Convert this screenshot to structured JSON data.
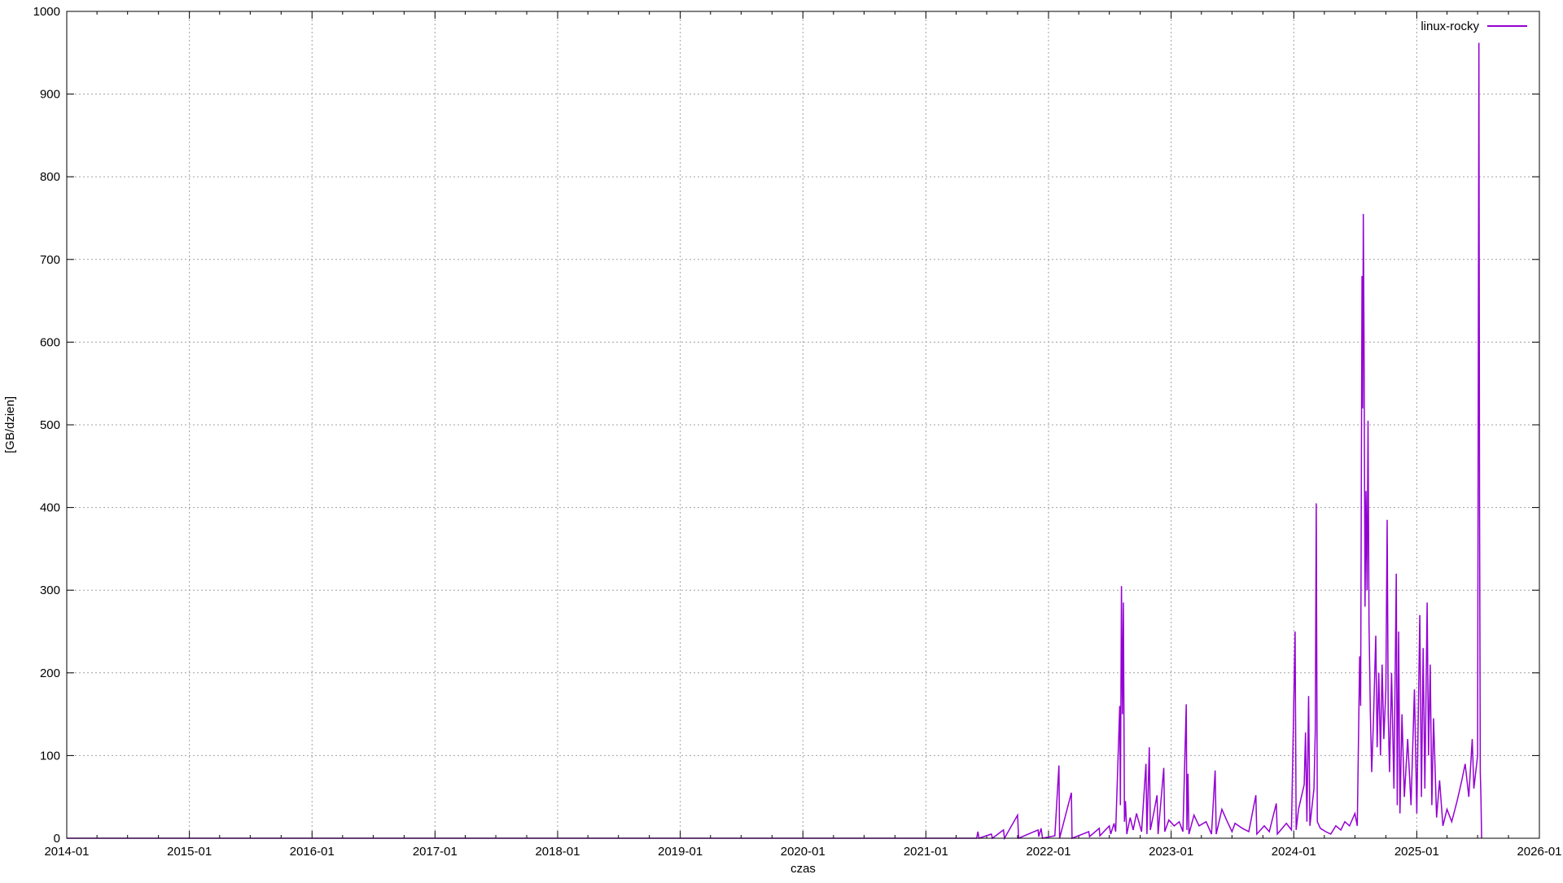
{
  "chart_data": {
    "type": "line",
    "title": "",
    "xlabel": "czas",
    "ylabel": "[GB/dzien]",
    "x_tick_labels": [
      "2014-01",
      "2015-01",
      "2016-01",
      "2017-01",
      "2018-01",
      "2019-01",
      "2020-01",
      "2021-01",
      "2022-01",
      "2023-01",
      "2024-01",
      "2025-01",
      "2026-01"
    ],
    "y_tick_labels": [
      "0",
      "100",
      "200",
      "300",
      "400",
      "500",
      "600",
      "700",
      "800",
      "900",
      "1000"
    ],
    "xlim": [
      "2014-01-01",
      "2026-01-01"
    ],
    "ylim": [
      0,
      1000
    ],
    "grid": true,
    "legend_position": "top-right",
    "series": [
      {
        "name": "linux-rocky",
        "color": "#9400d3",
        "points": [
          [
            "2014-01-01",
            0
          ],
          [
            "2021-06-01",
            0
          ],
          [
            "2021-06-05",
            8
          ],
          [
            "2021-06-08",
            0
          ],
          [
            "2021-07-15",
            5
          ],
          [
            "2021-07-18",
            0
          ],
          [
            "2021-08-20",
            10
          ],
          [
            "2021-08-23",
            0
          ],
          [
            "2021-10-01",
            28
          ],
          [
            "2021-10-04",
            0
          ],
          [
            "2021-12-01",
            10
          ],
          [
            "2021-12-03",
            2
          ],
          [
            "2021-12-10",
            12
          ],
          [
            "2021-12-14",
            0
          ],
          [
            "2022-01-20",
            3
          ],
          [
            "2022-02-01",
            88
          ],
          [
            "2022-02-03",
            0
          ],
          [
            "2022-03-10",
            55
          ],
          [
            "2022-03-12",
            0
          ],
          [
            "2022-05-01",
            8
          ],
          [
            "2022-05-03",
            2
          ],
          [
            "2022-06-01",
            12
          ],
          [
            "2022-06-03",
            3
          ],
          [
            "2022-07-01",
            15
          ],
          [
            "2022-07-05",
            5
          ],
          [
            "2022-07-15",
            18
          ],
          [
            "2022-07-20",
            8
          ],
          [
            "2022-08-01",
            160
          ],
          [
            "2022-08-03",
            40
          ],
          [
            "2022-08-06",
            305
          ],
          [
            "2022-08-09",
            150
          ],
          [
            "2022-08-12",
            285
          ],
          [
            "2022-08-15",
            20
          ],
          [
            "2022-08-18",
            45
          ],
          [
            "2022-08-22",
            5
          ],
          [
            "2022-09-01",
            25
          ],
          [
            "2022-09-10",
            10
          ],
          [
            "2022-09-20",
            30
          ],
          [
            "2022-10-05",
            8
          ],
          [
            "2022-10-18",
            90
          ],
          [
            "2022-10-21",
            5
          ],
          [
            "2022-10-28",
            110
          ],
          [
            "2022-10-31",
            10
          ],
          [
            "2022-11-10",
            30
          ],
          [
            "2022-11-20",
            52
          ],
          [
            "2022-11-23",
            5
          ],
          [
            "2022-12-10",
            85
          ],
          [
            "2022-12-13",
            8
          ],
          [
            "2022-12-25",
            22
          ],
          [
            "2023-01-10",
            15
          ],
          [
            "2023-01-25",
            20
          ],
          [
            "2023-02-05",
            8
          ],
          [
            "2023-02-15",
            162
          ],
          [
            "2023-02-17",
            10
          ],
          [
            "2023-02-20",
            78
          ],
          [
            "2023-02-23",
            5
          ],
          [
            "2023-03-10",
            28
          ],
          [
            "2023-03-25",
            15
          ],
          [
            "2023-04-15",
            20
          ],
          [
            "2023-05-01",
            5
          ],
          [
            "2023-05-12",
            82
          ],
          [
            "2023-05-15",
            5
          ],
          [
            "2023-06-01",
            35
          ],
          [
            "2023-06-15",
            22
          ],
          [
            "2023-07-01",
            8
          ],
          [
            "2023-07-10",
            18
          ],
          [
            "2023-08-01",
            12
          ],
          [
            "2023-08-20",
            8
          ],
          [
            "2023-09-10",
            52
          ],
          [
            "2023-09-13",
            5
          ],
          [
            "2023-10-05",
            15
          ],
          [
            "2023-10-20",
            8
          ],
          [
            "2023-11-10",
            42
          ],
          [
            "2023-11-13",
            5
          ],
          [
            "2023-12-10",
            18
          ],
          [
            "2023-12-25",
            10
          ],
          [
            "2024-01-05",
            250
          ],
          [
            "2024-01-08",
            10
          ],
          [
            "2024-01-15",
            35
          ],
          [
            "2024-02-01",
            65
          ],
          [
            "2024-02-05",
            128
          ],
          [
            "2024-02-09",
            20
          ],
          [
            "2024-02-14",
            172
          ],
          [
            "2024-02-18",
            15
          ],
          [
            "2024-03-01",
            60
          ],
          [
            "2024-03-05",
            130
          ],
          [
            "2024-03-08",
            405
          ],
          [
            "2024-03-11",
            20
          ],
          [
            "2024-03-20",
            12
          ],
          [
            "2024-04-05",
            8
          ],
          [
            "2024-04-20",
            5
          ],
          [
            "2024-05-05",
            15
          ],
          [
            "2024-05-20",
            10
          ],
          [
            "2024-06-01",
            20
          ],
          [
            "2024-06-15",
            15
          ],
          [
            "2024-07-01",
            30
          ],
          [
            "2024-07-08",
            15
          ],
          [
            "2024-07-15",
            220
          ],
          [
            "2024-07-18",
            160
          ],
          [
            "2024-07-22",
            680
          ],
          [
            "2024-07-24",
            520
          ],
          [
            "2024-07-26",
            755
          ],
          [
            "2024-07-28",
            600
          ],
          [
            "2024-07-31",
            280
          ],
          [
            "2024-08-03",
            420
          ],
          [
            "2024-08-06",
            300
          ],
          [
            "2024-08-09",
            505
          ],
          [
            "2024-08-12",
            260
          ],
          [
            "2024-08-16",
            150
          ],
          [
            "2024-08-20",
            80
          ],
          [
            "2024-08-25",
            140
          ],
          [
            "2024-09-01",
            245
          ],
          [
            "2024-09-05",
            110
          ],
          [
            "2024-09-10",
            200
          ],
          [
            "2024-09-15",
            100
          ],
          [
            "2024-09-20",
            210
          ],
          [
            "2024-09-25",
            120
          ],
          [
            "2024-10-01",
            180
          ],
          [
            "2024-10-05",
            385
          ],
          [
            "2024-10-08",
            150
          ],
          [
            "2024-10-12",
            80
          ],
          [
            "2024-10-18",
            200
          ],
          [
            "2024-10-25",
            60
          ],
          [
            "2024-11-01",
            320
          ],
          [
            "2024-11-04",
            40
          ],
          [
            "2024-11-08",
            250
          ],
          [
            "2024-11-12",
            30
          ],
          [
            "2024-11-18",
            150
          ],
          [
            "2024-11-25",
            50
          ],
          [
            "2024-12-05",
            120
          ],
          [
            "2024-12-15",
            40
          ],
          [
            "2024-12-25",
            180
          ],
          [
            "2025-01-01",
            30
          ],
          [
            "2025-01-10",
            270
          ],
          [
            "2025-01-15",
            50
          ],
          [
            "2025-01-20",
            230
          ],
          [
            "2025-01-25",
            60
          ],
          [
            "2025-02-01",
            285
          ],
          [
            "2025-02-05",
            100
          ],
          [
            "2025-02-10",
            210
          ],
          [
            "2025-02-15",
            40
          ],
          [
            "2025-02-20",
            145
          ],
          [
            "2025-03-01",
            25
          ],
          [
            "2025-03-10",
            70
          ],
          [
            "2025-03-20",
            15
          ],
          [
            "2025-04-01",
            35
          ],
          [
            "2025-04-15",
            20
          ],
          [
            "2025-05-01",
            45
          ],
          [
            "2025-05-15",
            70
          ],
          [
            "2025-05-25",
            90
          ],
          [
            "2025-06-05",
            50
          ],
          [
            "2025-06-15",
            120
          ],
          [
            "2025-06-20",
            60
          ],
          [
            "2025-07-01",
            100
          ],
          [
            "2025-07-05",
            962
          ],
          [
            "2025-07-07",
            400
          ],
          [
            "2025-07-09",
            80
          ],
          [
            "2025-07-11",
            50
          ],
          [
            "2025-07-13",
            0
          ]
        ]
      }
    ]
  }
}
